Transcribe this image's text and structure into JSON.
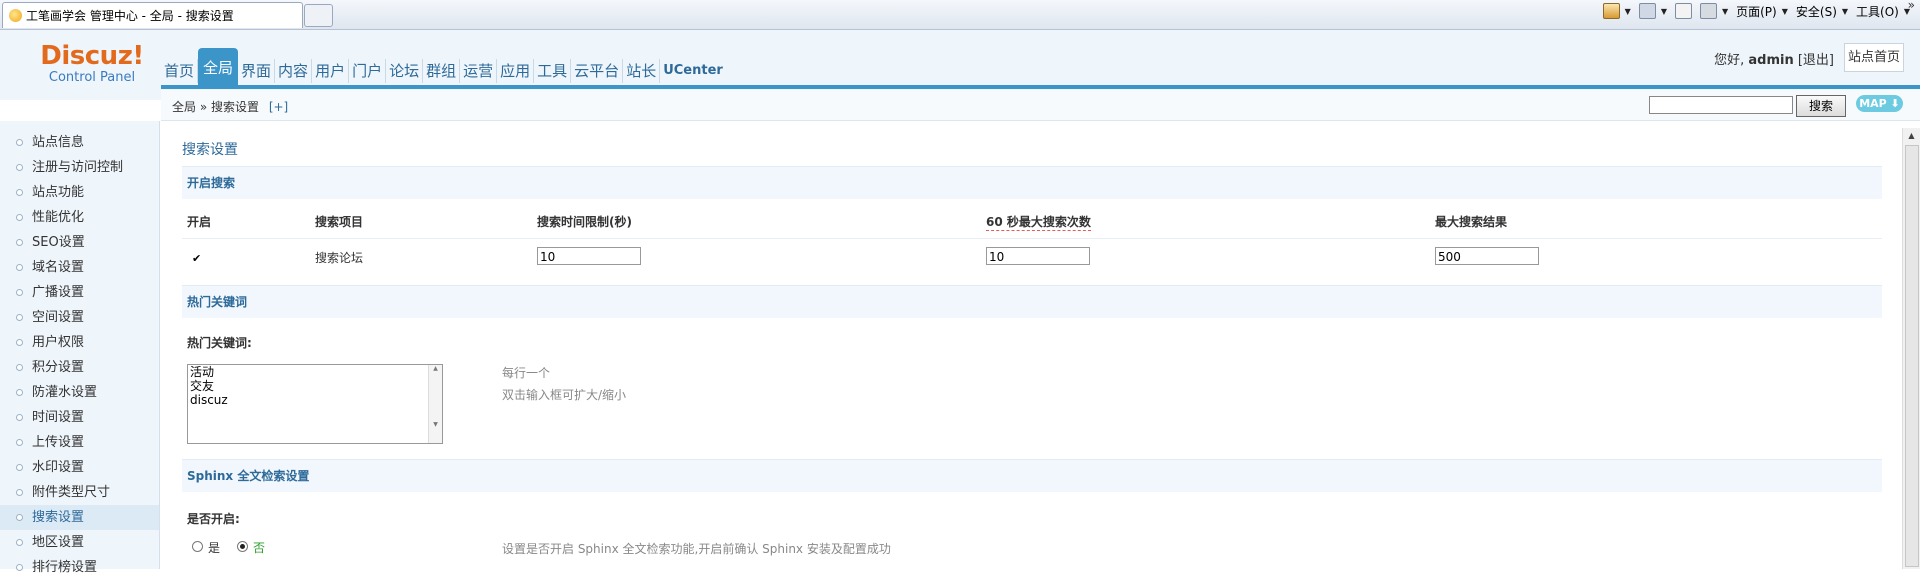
{
  "browser": {
    "tab_title": "工笔画学会 管理中心 - 全局 - 搜索设置",
    "commands": {
      "page": "页面(P)",
      "safety": "安全(S)",
      "tools": "工具(O)"
    },
    "icons": [
      "home-icon",
      "feeds-icon",
      "read-mail-icon",
      "print-icon"
    ]
  },
  "header": {
    "logo": {
      "brand": "Discuz!",
      "sub": "Control Panel"
    },
    "nav": [
      "首页",
      "全局",
      "界面",
      "内容",
      "用户",
      "门户",
      "论坛",
      "群组",
      "运营",
      "应用",
      "工具",
      "云平台",
      "站长",
      "UCenter"
    ],
    "active_nav": "全局",
    "user": {
      "greeting": "您好,",
      "name": "admin",
      "logout": "[退出]"
    },
    "site_home": "站点首页"
  },
  "breadcrumb": {
    "path": "全局 » 搜索设置",
    "toggle": "[+]"
  },
  "search": {
    "button": "搜索",
    "map": "MAP ⬇"
  },
  "sidebar": {
    "items": [
      "站点信息",
      "注册与访问控制",
      "站点功能",
      "性能优化",
      "SEO设置",
      "域名设置",
      "广播设置",
      "空间设置",
      "用户权限",
      "积分设置",
      "防灌水设置",
      "时间设置",
      "上传设置",
      "水印设置",
      "附件类型尺寸",
      "搜索设置",
      "地区设置",
      "排行榜设置"
    ],
    "active": "搜索设置"
  },
  "main": {
    "title": "搜索设置",
    "section_open": {
      "title": "开启搜索",
      "columns": [
        "开启",
        "搜索项目",
        "搜索时间限制(秒)",
        "60 秒最大搜索次数",
        "最大搜索结果"
      ],
      "row": {
        "enabled": "✔",
        "item": "搜索论坛",
        "time_limit": "10",
        "max_per_60s": "10",
        "max_results": "500"
      }
    },
    "section_hot": {
      "title": "热门关键词",
      "label": "热门关键词:",
      "keywords": [
        "活动",
        "交友",
        "discuz"
      ],
      "hint1": "每行一个",
      "hint2": "双击输入框可扩大/缩小"
    },
    "section_sphinx": {
      "title": "Sphinx 全文检索设置",
      "label": "是否开启:",
      "yes": "是",
      "no": "否",
      "selected": "否",
      "hint": "设置是否开启 Sphinx 全文检索功能,开启前确认 Sphinx 安装及配置成功"
    }
  },
  "colors": {
    "accent": "#3b95c9",
    "logo": "#e26a1c",
    "link": "#2e6a99",
    "selected_no": "#2a9d2a"
  }
}
